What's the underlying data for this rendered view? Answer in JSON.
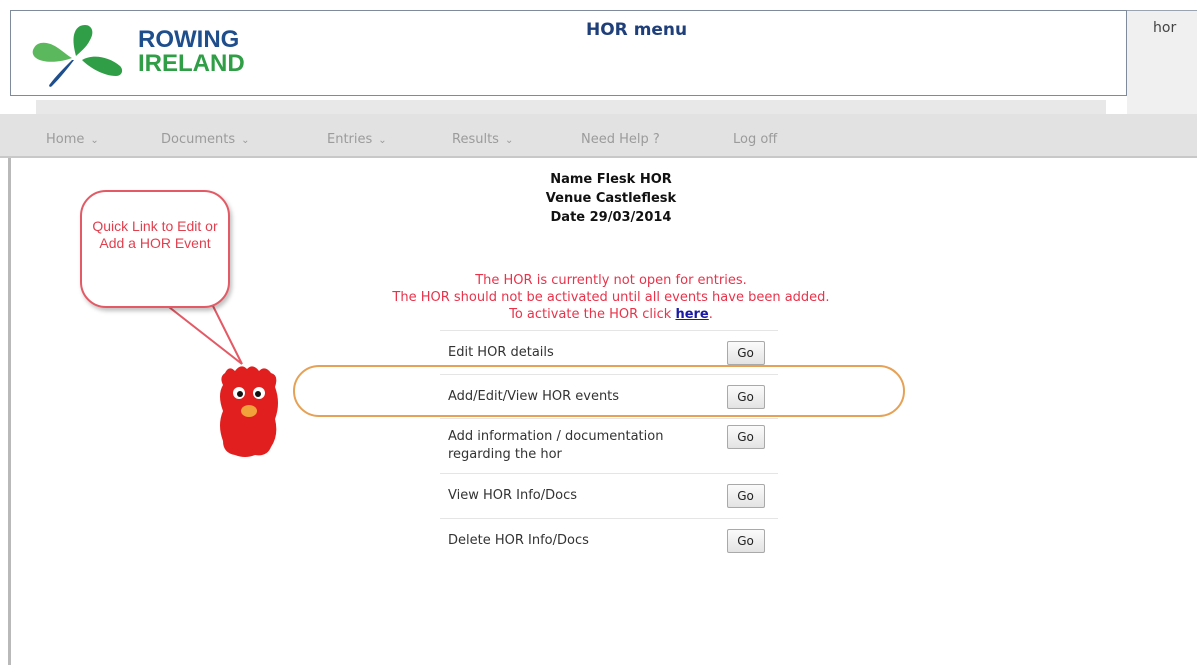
{
  "header": {
    "brand_line1": "ROWING",
    "brand_line2": "IRELAND",
    "page_title": "HOR menu",
    "user_label": "hor"
  },
  "nav": {
    "items": [
      {
        "label": "Home",
        "has_dropdown": true
      },
      {
        "label": "Documents",
        "has_dropdown": true
      },
      {
        "label": "Entries",
        "has_dropdown": true
      },
      {
        "label": "Results",
        "has_dropdown": true
      },
      {
        "label": "Need Help ?",
        "has_dropdown": false
      },
      {
        "label": "Log off",
        "has_dropdown": false
      }
    ],
    "caret": "⌄"
  },
  "event_info": {
    "name_line": "Name Flesk HOR",
    "venue_line": "Venue Castleflesk",
    "date_line": "Date 29/03/2014"
  },
  "notice": {
    "line1": "The HOR is currently not open for entries.",
    "line2": "The HOR should not be activated until all events have been added.",
    "line3_prefix": "To activate the HOR click ",
    "link": "here",
    "line3_suffix": "."
  },
  "menu": {
    "rows": [
      {
        "label": "Edit HOR details",
        "button": "Go"
      },
      {
        "label": "Add/Edit/View HOR events",
        "button": "Go"
      },
      {
        "label": "Add information / documentation regarding the hor",
        "button": "Go"
      },
      {
        "label": "View HOR Info/Docs",
        "button": "Go"
      },
      {
        "label": "Delete HOR Info/Docs",
        "button": "Go"
      }
    ]
  },
  "callout": {
    "text": "Quick Link to Edit or Add a HOR Event"
  },
  "colors": {
    "brand_blue": "#1f4e8c",
    "brand_green": "#2f9e46",
    "notice_red": "#e8334a",
    "highlight_orange": "#e6a155",
    "callout_red": "#e35a65"
  }
}
